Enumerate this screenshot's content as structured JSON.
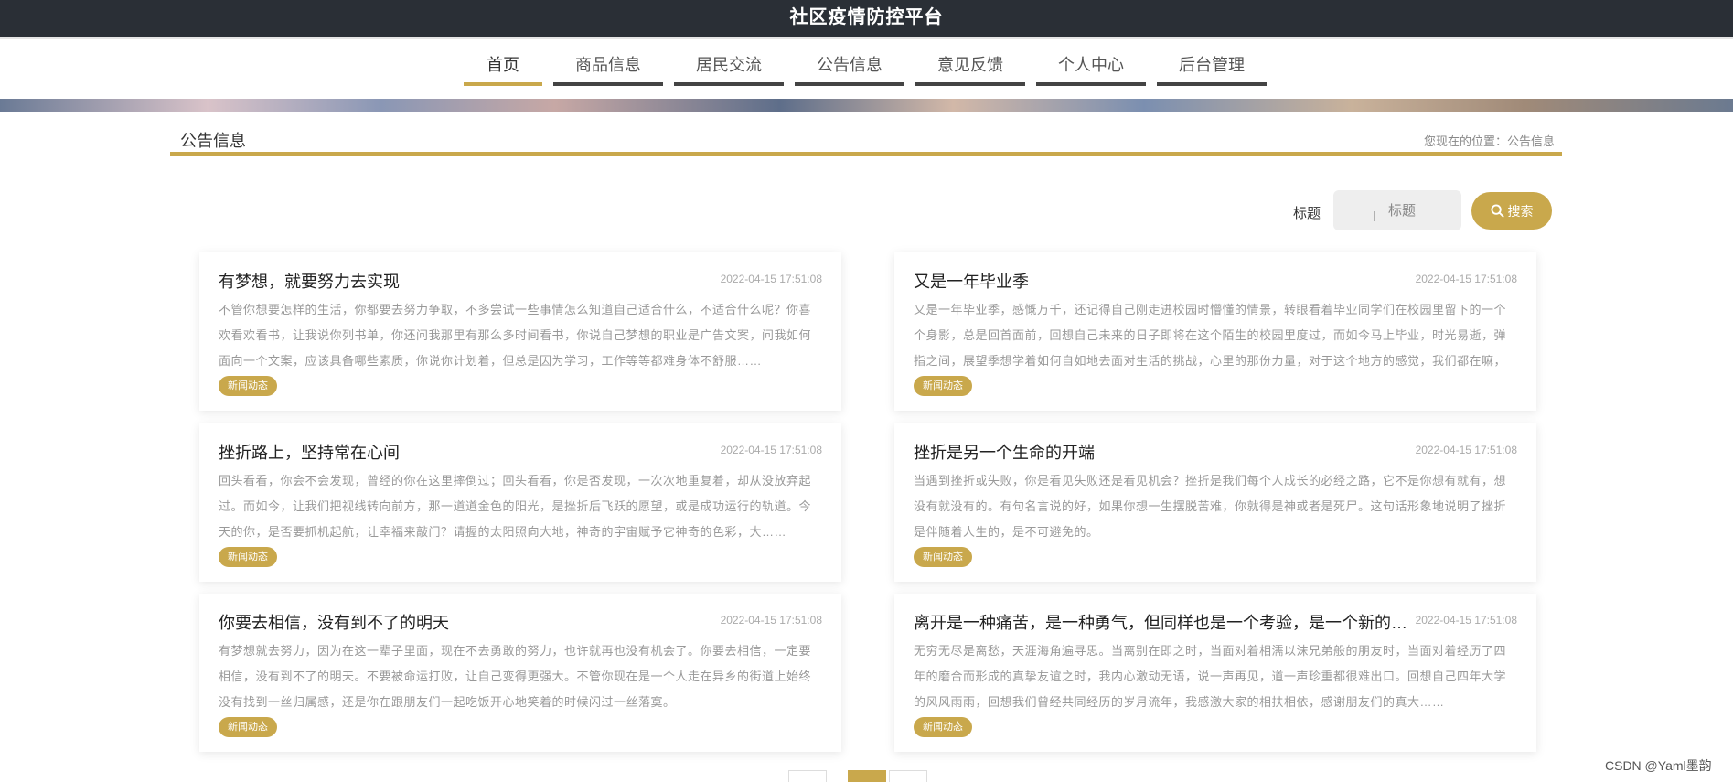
{
  "header": {
    "title": "社区疫情防控平台"
  },
  "nav": {
    "items": [
      {
        "label": "首页"
      },
      {
        "label": "商品信息"
      },
      {
        "label": "居民交流"
      },
      {
        "label": "公告信息"
      },
      {
        "label": "意见反馈"
      },
      {
        "label": "个人中心"
      },
      {
        "label": "后台管理"
      }
    ],
    "active": "首页"
  },
  "section": {
    "title": "公告信息",
    "breadcrumb": "您现在的位置：公告信息"
  },
  "search": {
    "label": "标题",
    "placeholder": "标题",
    "button_label": "搜索"
  },
  "notices": [
    {
      "title": "有梦想，就要努力去实现",
      "date": "2022-04-15 17:51:08",
      "summary": "不管你想要怎样的生活，你都要去努力争取，不多尝试一些事情怎么知道自己适合什么，不适合什么呢？你喜欢看欢看书，让我说你列书单，你还问我那里有那么多时间看书，你说自己梦想的职业是广告文案，问我如何面向一个文案，应该具备哪些素质，你说你计划着，但总是因为学习，工作等等都难身体不舒服……",
      "tag": "新闻动态"
    },
    {
      "title": "又是一年毕业季",
      "date": "2022-04-15 17:51:08",
      "summary": "又是一年毕业季，感慨万千，还记得自己刚走进校园时懵懂的情景，转眼看着毕业同学们在校园里留下的一个个身影，总是回首面前，回想自己未来的日子即将在这个陌生的校园里度过，而如今马上毕业，时光易逝，弹指之间，展望季想学着如何自如地去面对生活的挑战，心里的那份力量，对于这个地方的感觉，我们都在嘛，昂扬，跨越……",
      "tag": "新闻动态"
    },
    {
      "title": "挫折路上，坚持常在心间",
      "date": "2022-04-15 17:51:08",
      "summary": "回头看看，你会不会发现，曾经的你在这里摔倒过；回头看看，你是否发现，一次次地重复着，却从没放弃起过。而如今，让我们把视线转向前方，那一道道金色的阳光，是挫折后飞跃的愿望，或是成功运行的轨道。今天的你，是否要抓机起航，让幸福来敲门？请握的太阳照向大地，神奇的宇宙赋予它神奇的色彩，大……",
      "tag": "新闻动态"
    },
    {
      "title": "挫折是另一个生命的开端",
      "date": "2022-04-15 17:51:08",
      "summary": "当遇到挫折或失败，你是看见失败还是看见机会？挫折是我们每个人成长的必经之路，它不是你想有就有，想没有就没有的。有句名言说的好，如果你想一生摆脱苦难，你就得是神或者是死尸。这句话形象地说明了挫折是伴随着人生的，是不可避免的。",
      "tag": "新闻动态"
    },
    {
      "title": "你要去相信，没有到不了的明天",
      "date": "2022-04-15 17:51:08",
      "summary": "有梦想就去努力，因为在这一辈子里面，现在不去勇敢的努力，也许就再也没有机会了。你要去相信，一定要相信，没有到不了的明天。不要被命运打败，让自己变得更强大。不管你现在是一个人走在异乡的街道上始终没有找到一丝归属感，还是你在跟朋友们一起吃饭开心地笑着的时候闪过一丝落寞。",
      "tag": "新闻动态"
    },
    {
      "title": "离开是一种痛苦，是一种勇气，但同样也是一个考验，是一个新的开始",
      "date": "2022-04-15 17:51:08",
      "summary": "无穷无尽是离愁，天涯海角遍寻思。当离别在即之时，当面对着相濡以沫兄弟般的朋友时，当面对着经历了四年的磨合而形成的真挚友谊之时，我内心激动无语，说一声再见，道一声珍重都很难出口。回想自己四年大学的风风雨雨，回想我们曾经共同经历的岁月流年，我感激大家的相扶相依，感谢朋友们的真大……",
      "tag": "新闻动态"
    }
  ],
  "footer": {
    "watermark": "CSDN @Yaml墨韵"
  }
}
